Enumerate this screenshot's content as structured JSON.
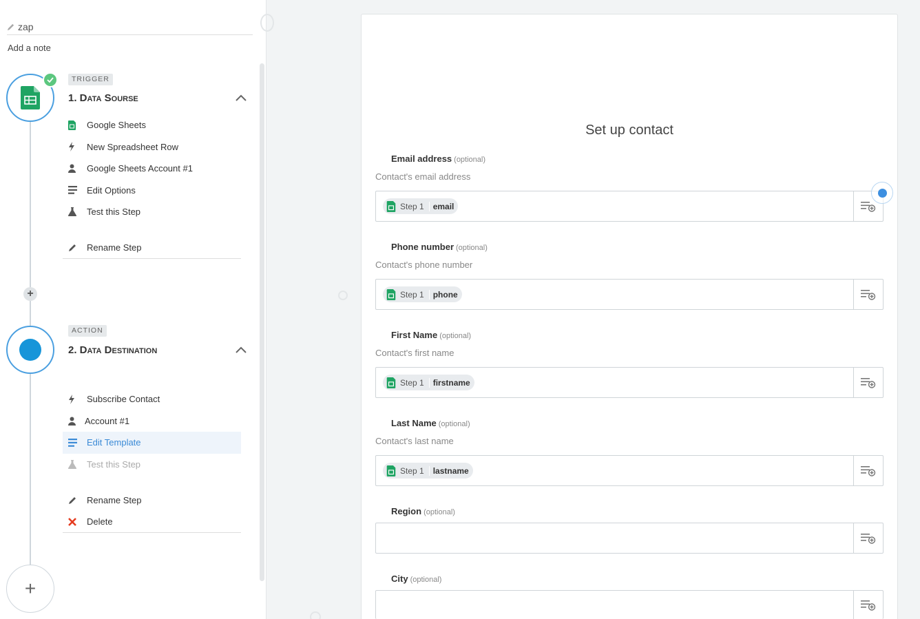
{
  "sidebar": {
    "zap_name": "zap",
    "add_note": "Add a note",
    "trigger": {
      "badge": "TRIGGER",
      "title": "1. Data Sourse",
      "items": [
        {
          "label": "Google Sheets",
          "icon": "google-sheets-icon"
        },
        {
          "label": "New Spreadsheet Row",
          "icon": "bolt-icon"
        },
        {
          "label": "Google Sheets Account #1",
          "icon": "user-icon"
        },
        {
          "label": "Edit Options",
          "icon": "list-icon"
        },
        {
          "label": "Test this Step",
          "icon": "flask-icon"
        }
      ],
      "rename": "Rename Step"
    },
    "action": {
      "badge": "ACTION",
      "title": "2. Data Destination",
      "items": [
        {
          "label": "Subscribe Contact",
          "icon": "bolt-icon"
        },
        {
          "label": "Account #1",
          "icon": "user-icon"
        },
        {
          "label": "Edit Template",
          "icon": "list-icon",
          "state": "active"
        },
        {
          "label": "Test this Step",
          "icon": "flask-icon",
          "state": "disabled"
        }
      ],
      "rename": "Rename Step",
      "delete": "Delete"
    },
    "add_step": "+"
  },
  "main": {
    "title": "Set up  contact",
    "optional_tag": "(optional)",
    "fields": [
      {
        "label": "Email address",
        "help": "Contact's email address",
        "pill_step": "Step 1",
        "pill_value": "email"
      },
      {
        "label": "Phone number",
        "help": "Contact's phone number",
        "pill_step": "Step 1",
        "pill_value": "phone"
      },
      {
        "label": "First Name",
        "help": "Contact's first name",
        "pill_step": "Step 1",
        "pill_value": "firstname"
      },
      {
        "label": "Last Name",
        "help": "Contact's last name",
        "pill_step": "Step 1",
        "pill_value": "lastname"
      },
      {
        "label": "Region",
        "help": "",
        "pill_step": "",
        "pill_value": ""
      },
      {
        "label": "City",
        "help": "",
        "pill_step": "",
        "pill_value": ""
      }
    ]
  },
  "colors": {
    "accent": "#1795d9",
    "success": "#5cc77f",
    "sheets_green": "#1fa463",
    "delete_red": "#e53c20"
  }
}
